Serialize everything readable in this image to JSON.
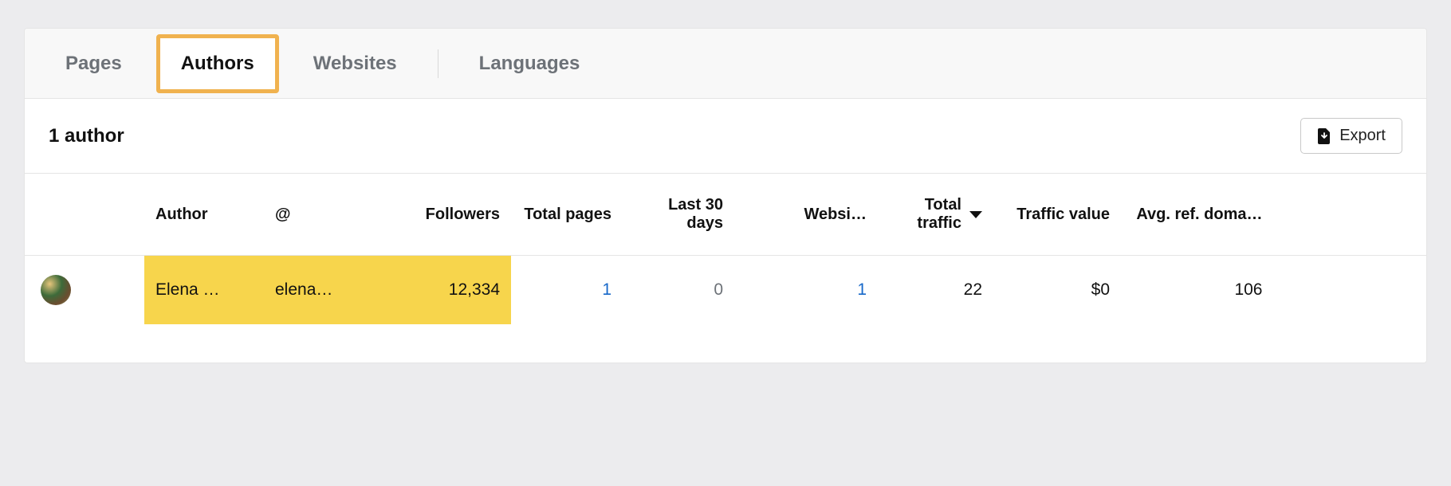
{
  "tabs": {
    "pages": "Pages",
    "authors": "Authors",
    "websites": "Websites",
    "languages": "Languages",
    "active": "authors"
  },
  "header": {
    "count_label": "1 author",
    "export_label": "Export"
  },
  "columns": {
    "author": "Author",
    "handle": "@",
    "followers": "Followers",
    "total_pages": "Total pages",
    "last_30_days": "Last 30 days",
    "websites": "Websi…",
    "total_traffic": "Total traffic",
    "traffic_value": "Traffic value",
    "avg_ref_domains": "Avg. ref. doma…"
  },
  "sort": {
    "column": "total_traffic",
    "dir": "desc"
  },
  "rows": [
    {
      "author": "Elena …",
      "handle": "elena…",
      "followers": "12,334",
      "total_pages": "1",
      "last_30_days": "0",
      "websites": "1",
      "total_traffic": "22",
      "traffic_value": "$0",
      "avg_ref_domains": "106",
      "highlight": true
    }
  ]
}
